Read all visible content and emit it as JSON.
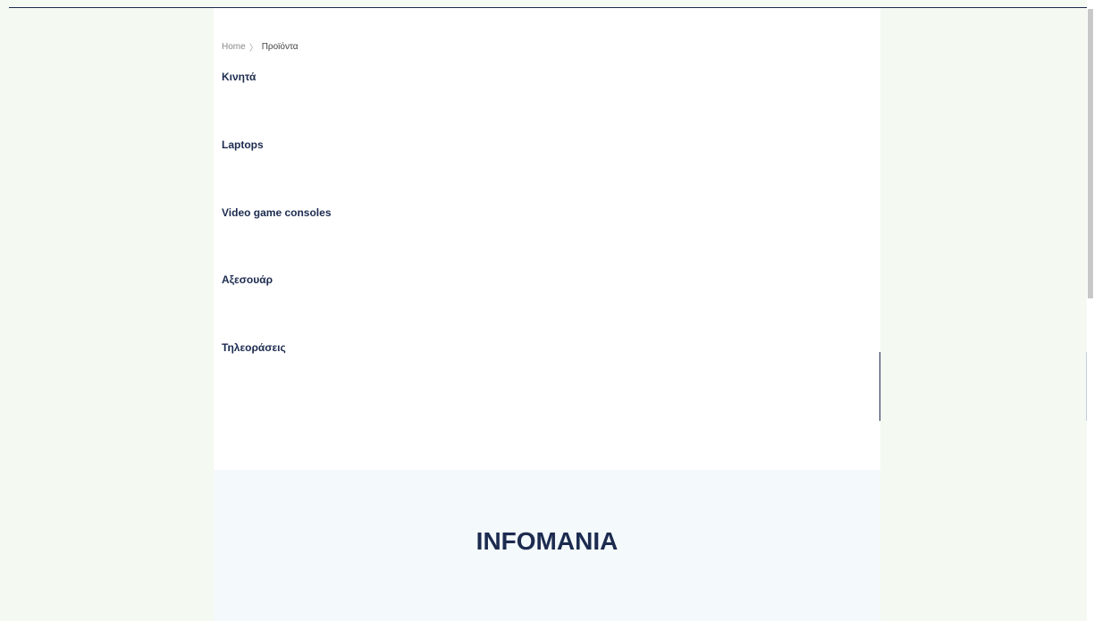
{
  "breadcrumb": {
    "home": "Home",
    "separator": "〉",
    "current": "Προϊόντα"
  },
  "categories": [
    {
      "label": "Κινητά"
    },
    {
      "label": "Laptops"
    },
    {
      "label": "Video game consoles"
    },
    {
      "label": "Αξεσουάρ"
    },
    {
      "label": "Τηλεοράσεις"
    }
  ],
  "footer": {
    "brand": "INFOMANIA"
  },
  "colors": {
    "accent": "#1c2b4f",
    "page_background": "#f4f9f2",
    "footer_background": "#f4f9fb"
  }
}
